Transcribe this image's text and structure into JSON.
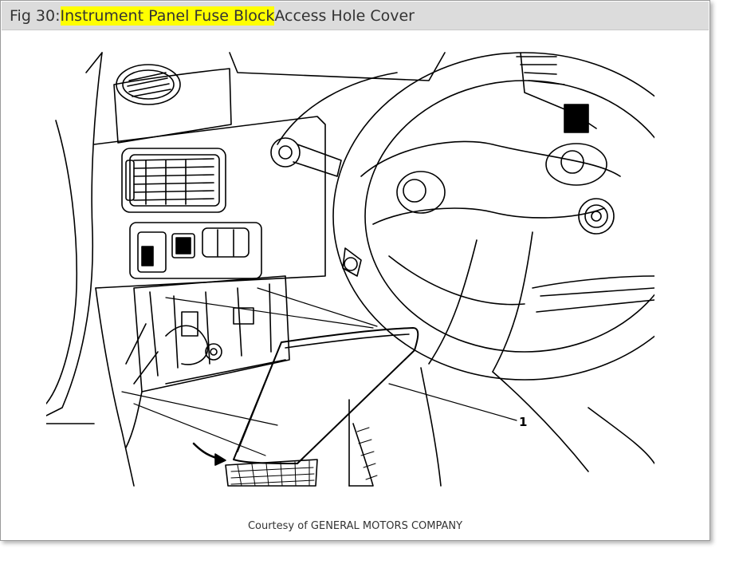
{
  "caption": {
    "prefix": "Fig 30: ",
    "highlighted": "Instrument Panel Fuse Block",
    "suffix": " Access Hole Cover",
    "highlight_color": "#ffff00"
  },
  "diagram": {
    "callouts": [
      {
        "label": "1"
      }
    ]
  },
  "credit": "Courtesy of GENERAL MOTORS COMPANY"
}
